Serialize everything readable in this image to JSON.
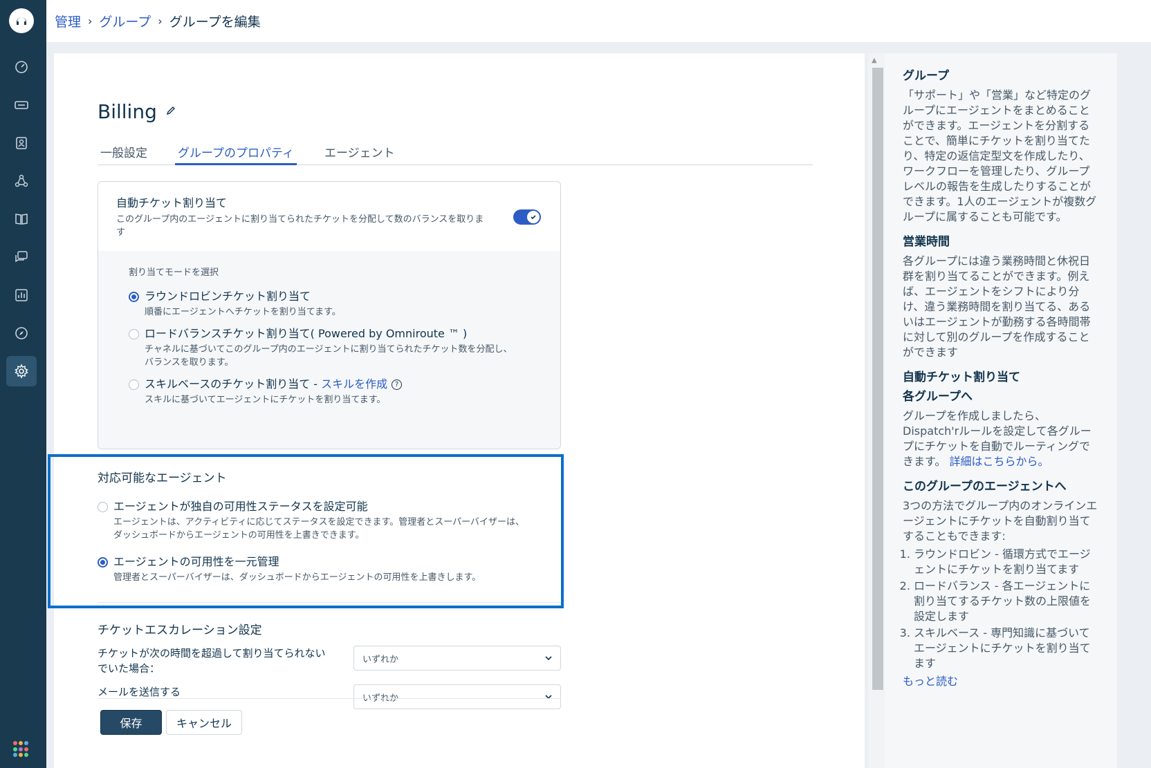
{
  "breadcrumb": {
    "items": [
      "管理",
      "グループ"
    ],
    "current": "グループを編集"
  },
  "nav": {
    "icons": [
      "logo-icon",
      "dashboard-icon",
      "tickets-icon",
      "contacts-icon",
      "groups-icon",
      "knowledge-base-icon",
      "forums-icon",
      "reports-icon",
      "discover-icon",
      "settings-icon",
      "apps-icon"
    ],
    "active": "settings-icon"
  },
  "page": {
    "title": "Billing",
    "tabs": [
      "一般設定",
      "グループのプロパティ",
      "エージェント"
    ],
    "active_tab": "グループのプロパティ"
  },
  "auto_assign": {
    "heading": "自動チケット割り当て",
    "description": "このグループ内のエージェントに割り当てられたチケットを分配して数のバランスを取ります",
    "enabled": true,
    "mode_label": "割り当てモードを選択",
    "options": [
      {
        "label": "ラウンドロビンチケット割り当て",
        "desc": "順番にエージェントへチケットを割り当てます。",
        "selected": true
      },
      {
        "label": "ロードバランスチケット割り当て( Powered by Omniroute ™ )",
        "desc": "チャネルに基づいてこのグループ内のエージェントに割り当てられたチケット数を分配し、バランスを取ります。",
        "selected": false
      },
      {
        "label": "スキルベースのチケット割り当て - ",
        "link": "スキルを作成",
        "desc": "スキルに基づいてエージェントにチケットを割り当てます。",
        "selected": false
      }
    ]
  },
  "availability": {
    "heading": "対応可能なエージェント",
    "options": [
      {
        "label": "エージェントが独自の可用性ステータスを設定可能",
        "desc": "エージェントは、アクティビティに応じてステータスを設定できます。管理者とスーパーバイザーは、ダッシュボードからエージェントの可用性を上書きできます。",
        "selected": false
      },
      {
        "label": "エージェントの可用性を一元管理",
        "desc": "管理者とスーパーバイザーは、ダッシュボードからエージェントの可用性を上書きします。",
        "selected": true
      }
    ]
  },
  "escalation": {
    "heading": "チケットエスカレーション設定",
    "rows": [
      {
        "label": "チケットが次の時間を超過して割り当てられないでいた場合：",
        "value": "いずれか"
      },
      {
        "label": "メールを送信する",
        "value": "いずれか"
      }
    ]
  },
  "buttons": {
    "save": "保存",
    "cancel": "キャンセル"
  },
  "help": {
    "group_title": "グループ",
    "group_text": "「サポート」や「営業」など特定のグループにエージェントをまとめることができます。エージェントを分割することで、簡単にチケットを割り当てたり、特定の返信定型文を作成したり、ワークフローを管理したり、グループレベルの報告を生成したりすることができます。1人のエージェントが複数グループに属することも可能です。",
    "hours_title": "営業時間",
    "hours_text": "各グループには違う業務時間と休祝日群を割り当てることができます。例えば、エージェントをシフトにより分け、違う業務時間を割り当てる、あるいはエージェントが勤務する各時間帯に対して別のグループを作成することができます",
    "auto_title": "自動チケット割り当て",
    "each_group_title": "各グループへ",
    "each_group_text": "グループを作成しましたら、Dispatch'rルールを設定して各グループにチケットを自動でルーティングできます。",
    "each_group_link": "詳細はこちらから。",
    "agents_title": "このグループのエージェントへ",
    "agents_text": "3つの方法でグループ内のオンラインエージェントにチケットを自動割り当てすることもできます:",
    "agents_list": [
      "ラウンドロビン - 循環方式でエージェントにチケットを割り当てます",
      "ロードバランス - 各エージェントに割り当てするチケット数の上限値を設定します",
      "スキルベース - 専門知識に基づいてエージェントにチケットを割り当てます"
    ],
    "more": "もっと読む"
  }
}
